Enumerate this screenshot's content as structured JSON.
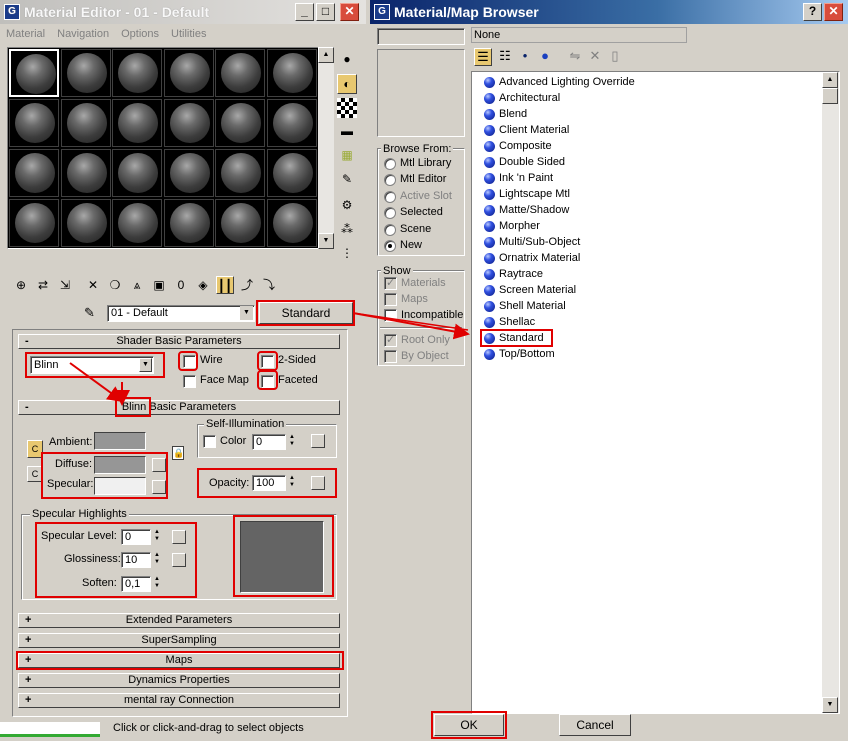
{
  "material_editor": {
    "title": "Material Editor - 01 - Default",
    "menu": [
      "Material",
      "Navigation",
      "Options",
      "Utilities"
    ],
    "material_name": "01 - Default",
    "type_button": "Standard",
    "shader_rollout": {
      "title": "Shader Basic Parameters",
      "shader": "Blinn",
      "wire": "Wire",
      "two_sided": "2-Sided",
      "face_map": "Face Map",
      "faceted": "Faceted"
    },
    "blinn_rollout": {
      "title_highlight": "Blinn",
      "title_rest": " Basic Parameters",
      "ambient": "Ambient:",
      "diffuse": "Diffuse:",
      "specular": "Specular:",
      "self_illum_group": "Self-Illumination",
      "color_label": "Color",
      "color_value": "0",
      "opacity_label": "Opacity:",
      "opacity_value": "100",
      "spec_group": "Specular Highlights",
      "spec_level_label": "Specular Level:",
      "spec_level_value": "0",
      "glossiness_label": "Glossiness:",
      "glossiness_value": "10",
      "soften_label": "Soften:",
      "soften_value": "0,1"
    },
    "collapsed_rollouts": [
      "Extended Parameters",
      "SuperSampling",
      "Maps",
      "Dynamics Properties",
      "mental ray Connection"
    ],
    "status_text": "Click or click-and-drag to select objects",
    "minus": "-",
    "plus": "+"
  },
  "browser": {
    "title": "Material/Map Browser",
    "search_value": "",
    "preview_label": "None",
    "browse_from": {
      "title": "Browse From:",
      "options": [
        "Mtl Library",
        "Mtl Editor",
        "Active Slot",
        "Selected",
        "Scene",
        "New"
      ],
      "selected": "New"
    },
    "show": {
      "title": "Show",
      "options": [
        "Materials",
        "Maps",
        "Incompatible"
      ],
      "root_only": "Root Only",
      "by_object": "By Object"
    },
    "items": [
      "Advanced Lighting Override",
      "Architectural",
      "Blend",
      "Client Material",
      "Composite",
      "Double Sided",
      "Ink 'n Paint",
      "Lightscape Mtl",
      "Matte/Shadow",
      "Morpher",
      "Multi/Sub-Object",
      "Ornatrix Material",
      "Raytrace",
      "Screen Material",
      "Shell Material",
      "Shellac",
      "Standard",
      "Top/Bottom"
    ],
    "selected_item": "Standard",
    "ok": "OK",
    "cancel": "Cancel"
  },
  "colors": {
    "highlight_red": "#e00000",
    "titlebar_blue": "#0a246a"
  }
}
